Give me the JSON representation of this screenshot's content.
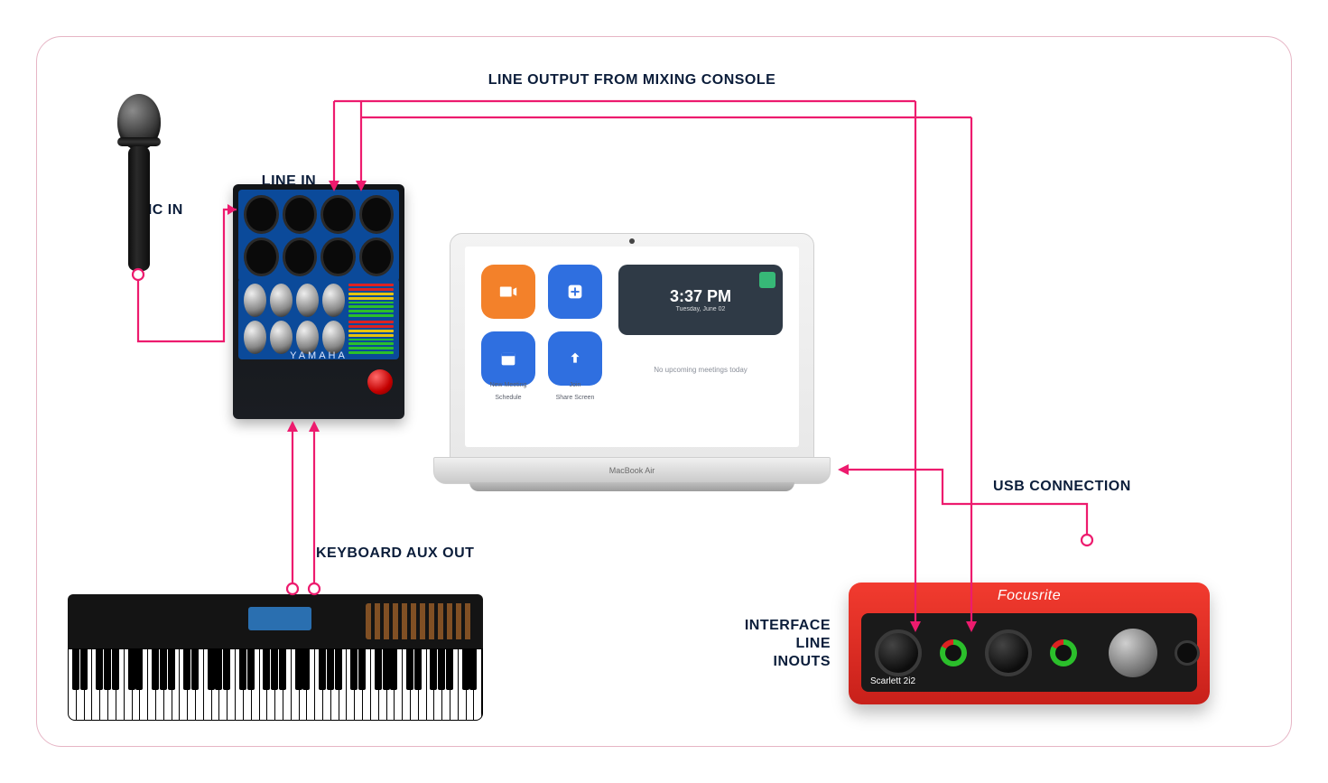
{
  "labels": {
    "lineOutput": "LINE OUTPUT FROM MIXING CONSOLE",
    "lineIn": "LINE IN",
    "micIn": "MIC IN",
    "keyboardAux": "KEYBOARD AUX OUT",
    "usb": "USB CONNECTION",
    "ifaceLineInputs1": "INTERFACE",
    "ifaceLineInputs2": "LINE",
    "ifaceLineInputs3": "INOUTS"
  },
  "mixer": {
    "brand": "YAMAHA"
  },
  "laptop": {
    "model": "MacBook Air",
    "clock": "3:37 PM",
    "clockSub": "Tuesday, June 02",
    "noMeetings": "No upcoming meetings today",
    "tiles": {
      "newMeeting": "New Meeting",
      "join": "Join",
      "schedule": "Schedule",
      "share": "Share Screen"
    }
  },
  "interface": {
    "logo": "Focusrite",
    "model": "Scarlett 2i2"
  },
  "colors": {
    "wire": "#ed1b6e",
    "navy": "#0b1d3a",
    "zoomOrange": "#f3812a",
    "zoomBlue": "#2f6fe0",
    "ifaceRed": "#e5281f"
  }
}
